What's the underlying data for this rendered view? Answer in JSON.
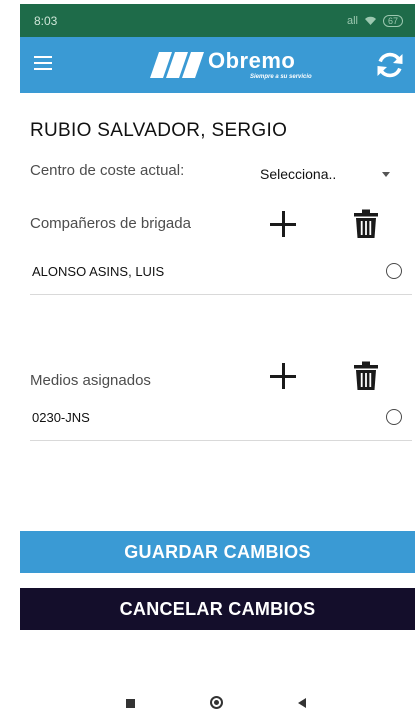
{
  "status_bar": {
    "time": "8:03",
    "signal": "all",
    "battery": "67"
  },
  "app_bar": {
    "logo_text": "Obremo",
    "logo_tagline": "Siempre a su servicio"
  },
  "worker": {
    "name": "RUBIO SALVADOR, SERGIO"
  },
  "cost_center": {
    "label": "Centro de coste actual:",
    "selected": "Selecciona.."
  },
  "brigade": {
    "label": "Compañeros de brigada",
    "members": [
      "ALONSO ASINS, LUIS"
    ]
  },
  "resources": {
    "label": "Medios asignados",
    "items": [
      "0230-JNS"
    ]
  },
  "actions": {
    "save_label": "GUARDAR CAMBIOS",
    "cancel_label": "CANCELAR CAMBIOS"
  },
  "colors": {
    "status_bar": "#1e6b49",
    "app_bar": "#3a9ad4",
    "save_button": "#3a9ad4",
    "cancel_button": "#140e2b"
  },
  "icons": {
    "menu": "hamburger-icon",
    "refresh": "refresh-icon",
    "add": "plus-icon",
    "delete": "trash-icon",
    "select": "radio-icon"
  }
}
